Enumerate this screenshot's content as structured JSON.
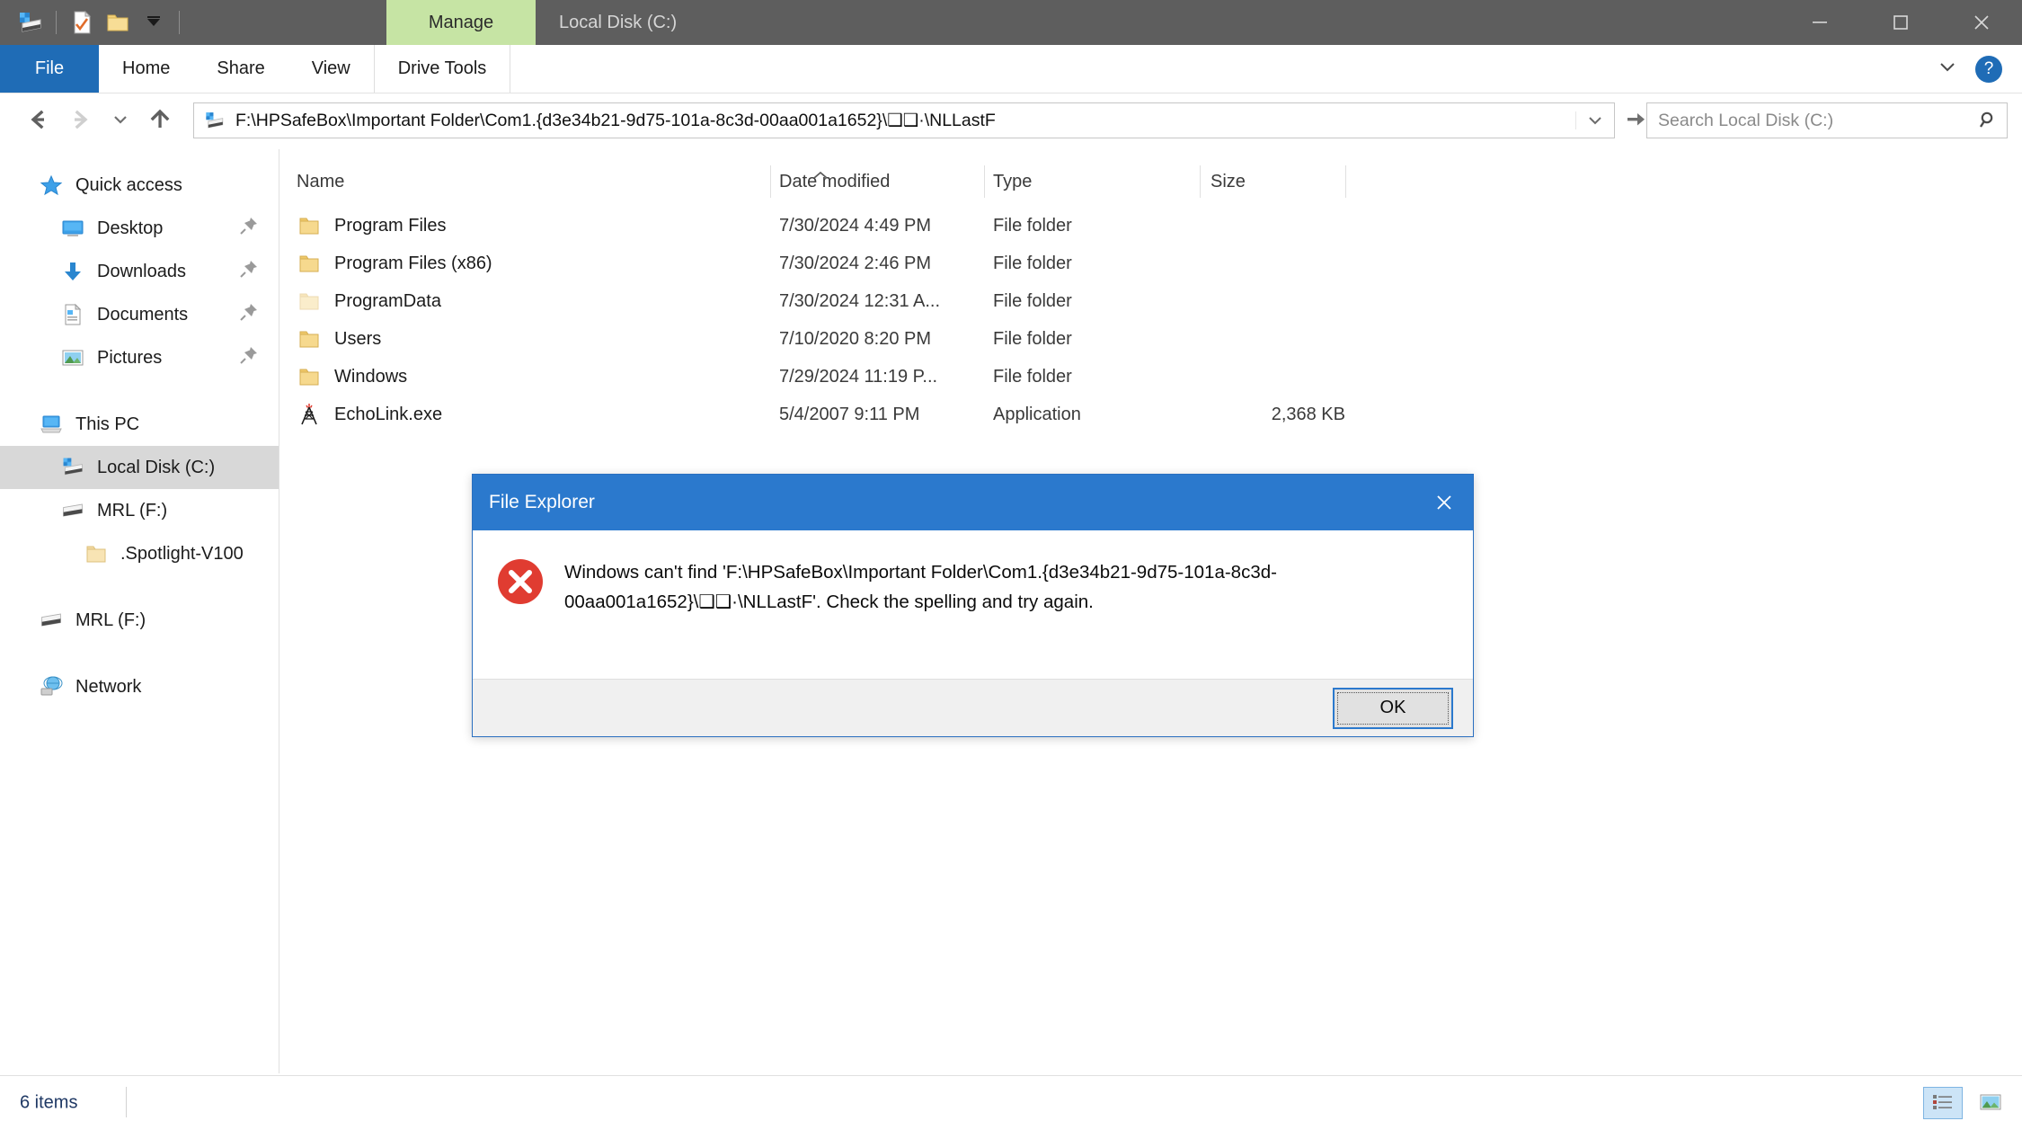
{
  "titlebar": {
    "contextual_tab": "Manage",
    "window_title": "Local Disk (C:)",
    "quick_access": [
      {
        "name": "drive-icon",
        "label": "Local Disk"
      },
      {
        "name": "properties-icon",
        "label": "Properties"
      },
      {
        "name": "new-folder-icon",
        "label": "New folder"
      },
      {
        "name": "customize-qat-chevron-icon",
        "label": "Customize Quick Access Toolbar"
      }
    ],
    "controls": {
      "minimize": "Minimize",
      "maximize": "Maximize",
      "close": "Close"
    }
  },
  "ribbon": {
    "file_tab": "File",
    "tabs": [
      "Home",
      "Share",
      "View"
    ],
    "contextual_tab": "Drive Tools",
    "collapse_label": "Minimize the Ribbon",
    "help_label": "?"
  },
  "navbar": {
    "back_label": "Back",
    "forward_label": "Forward",
    "recent_label": "Recent locations",
    "up_label": "Up",
    "address": "F:\\HPSafeBox\\Important Folder\\Com1.{d3e34b21-9d75-101a-8c3d-00aa001a1652}\\❑❑·\\NLLastF",
    "go_label": "Go to",
    "history_label": "Previous locations"
  },
  "search": {
    "placeholder": "Search Local Disk (C:)",
    "value": ""
  },
  "sidebar": {
    "items": [
      {
        "label": "Quick access",
        "icon": "star-icon",
        "indent": 0,
        "pinned": false,
        "selected": false
      },
      {
        "label": "Desktop",
        "icon": "desktop-icon",
        "indent": 1,
        "pinned": true,
        "selected": false
      },
      {
        "label": "Downloads",
        "icon": "downloads-icon",
        "indent": 1,
        "pinned": true,
        "selected": false
      },
      {
        "label": "Documents",
        "icon": "documents-icon",
        "indent": 1,
        "pinned": true,
        "selected": false
      },
      {
        "label": "Pictures",
        "icon": "pictures-icon",
        "indent": 1,
        "pinned": true,
        "selected": false
      },
      {
        "label": "This PC",
        "icon": "this-pc-icon",
        "indent": 0,
        "pinned": false,
        "selected": false
      },
      {
        "label": "Local Disk (C:)",
        "icon": "windows-drive-icon",
        "indent": 1,
        "pinned": false,
        "selected": true
      },
      {
        "label": "MRL (F:)",
        "icon": "drive-icon",
        "indent": 1,
        "pinned": false,
        "selected": false
      },
      {
        "label": ".Spotlight-V100",
        "icon": "folder-icon",
        "indent": 2,
        "pinned": false,
        "selected": false
      },
      {
        "label": "MRL (F:)",
        "icon": "drive-icon",
        "indent": 0,
        "pinned": false,
        "selected": false
      },
      {
        "label": "Network",
        "icon": "network-icon",
        "indent": 0,
        "pinned": false,
        "selected": false
      }
    ]
  },
  "filelist": {
    "columns": [
      "Name",
      "Date modified",
      "Type",
      "Size"
    ],
    "sort_column": "Name",
    "sort_direction": "ascending",
    "rows": [
      {
        "name": "Program Files",
        "date": "7/30/2024 4:49 PM",
        "type": "File folder",
        "size": "",
        "icon": "folder-icon"
      },
      {
        "name": "Program Files (x86)",
        "date": "7/30/2024 2:46 PM",
        "type": "File folder",
        "size": "",
        "icon": "folder-icon"
      },
      {
        "name": "ProgramData",
        "date": "7/30/2024 12:31 A...",
        "type": "File folder",
        "size": "",
        "icon": "folder-hidden-icon"
      },
      {
        "name": "Users",
        "date": "7/10/2020 8:20 PM",
        "type": "File folder",
        "size": "",
        "icon": "folder-icon"
      },
      {
        "name": "Windows",
        "date": "7/29/2024 11:19 P...",
        "type": "File folder",
        "size": "",
        "icon": "folder-icon"
      },
      {
        "name": "EchoLink.exe",
        "date": "5/4/2007 9:11 PM",
        "type": "Application",
        "size": "2,368 KB",
        "icon": "antenna-icon"
      }
    ]
  },
  "statusbar": {
    "item_count": "6 items",
    "details_view_label": "Details view",
    "large_icons_view_label": "Large icons view",
    "active_view": "details"
  },
  "dialog": {
    "title": "File Explorer",
    "close_label": "Close",
    "message": "Windows can't find 'F:\\HPSafeBox\\Important Folder\\Com1.{d3e34b21-9d75-101a-8c3d-00aa001a1652}\\❑❑·\\NLLastF'. Check the spelling and try again.",
    "ok_label": "OK",
    "icon": "error-icon"
  },
  "colors": {
    "titlebar_bg": "#5e5e5e",
    "file_tab_blue": "#1f6cb6",
    "contextual_tab_green": "#c6e4a4",
    "dialog_title_blue": "#2b79cd",
    "error_red": "#e03c31",
    "selection_gray": "#d8d8d8",
    "status_text_blue": "#1f3864"
  }
}
